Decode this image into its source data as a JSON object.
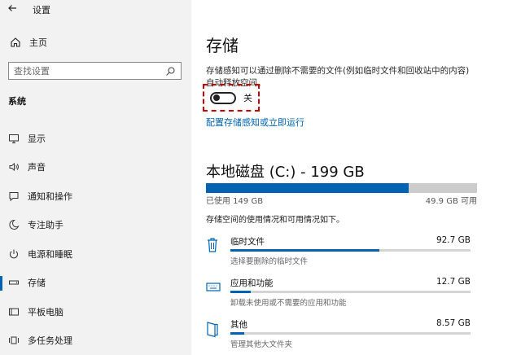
{
  "window": {
    "app_title": "设置",
    "back_icon": "back-arrow-icon"
  },
  "sidebar": {
    "home_label": "主页",
    "search_placeholder": "查找设置",
    "section_title": "系统",
    "items": [
      {
        "label": "显示",
        "icon": "display-icon"
      },
      {
        "label": "声音",
        "icon": "sound-icon"
      },
      {
        "label": "通知和操作",
        "icon": "notification-icon"
      },
      {
        "label": "专注助手",
        "icon": "focus-moon-icon"
      },
      {
        "label": "电源和睡眠",
        "icon": "power-icon"
      },
      {
        "label": "存储",
        "icon": "storage-icon",
        "selected": true
      },
      {
        "label": "平板电脑",
        "icon": "tablet-icon"
      },
      {
        "label": "多任务处理",
        "icon": "multitask-icon"
      }
    ]
  },
  "main": {
    "title": "存储",
    "description": "存储感知可以通过删除不需要的文件(例如临时文件和回收站中的内容)自动释放空间。",
    "toggle": {
      "state_label": "关",
      "on": false
    },
    "configure_link": "配置存储感知或立即运行",
    "disk": {
      "title": "本地磁盘 (C:) - 199 GB",
      "used_label": "已使用 149 GB",
      "free_label": "49.9 GB 可用",
      "used_fraction": 0.749,
      "description": "存储空间的使用情况和可用情况如下。"
    },
    "categories": [
      {
        "name": "临时文件",
        "size": "92.7 GB",
        "sub": "选择要删除的临时文件",
        "fraction": 0.62,
        "icon": "trash-icon"
      },
      {
        "name": "应用和功能",
        "size": "12.7 GB",
        "sub": "卸载未使用或不需要的应用和功能",
        "fraction": 0.085,
        "icon": "keyboard-icon"
      },
      {
        "name": "其他",
        "size": "8.57 GB",
        "sub": "管理其他大文件夹",
        "fraction": 0.058,
        "icon": "folder-icon"
      }
    ]
  },
  "colors": {
    "accent": "#0063b1",
    "highlight_border": "#c80000",
    "sidebar_bg": "#f2f2f2"
  }
}
